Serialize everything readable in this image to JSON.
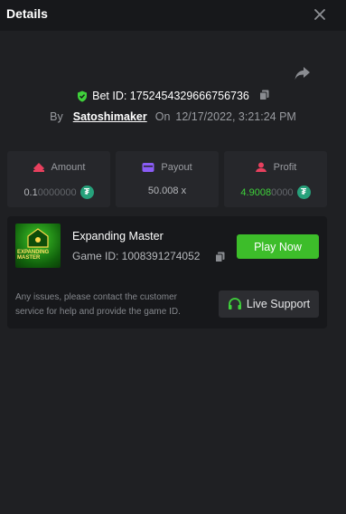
{
  "header": {
    "title": "Details"
  },
  "bet": {
    "id_label": "Bet ID: 1752454329666756736",
    "by_label": "By",
    "user": "Satoshimaker",
    "on_label": "On",
    "date": "12/17/2022, 3:21:24 PM"
  },
  "stats": {
    "amount": {
      "label": "Amount",
      "value_main": "0.1",
      "value_dim": "0000000"
    },
    "payout": {
      "label": "Payout",
      "value": "50.008 x"
    },
    "profit": {
      "label": "Profit",
      "value_main": "4.9008",
      "value_dim": "0000"
    }
  },
  "game": {
    "name": "Expanding Master",
    "id_label": "Game ID: 1008391274052",
    "thumb_text": "EXPANDING MASTER",
    "play_label": "Play Now",
    "notice": "Any issues, please contact the customer service for help and provide the game ID.",
    "support_label": "Live Support"
  },
  "colors": {
    "background": "#1f2023",
    "accent_green": "#3dbd2a",
    "tether": "#26a17b",
    "amount_icon": "#e8405e",
    "payout_icon": "#8a5cf6",
    "profit_icon": "#e8405e"
  },
  "icons": {
    "close": "close-icon",
    "share": "share-icon",
    "verified": "shield-check-icon",
    "copy": "copy-icon",
    "amount": "ticket-icon",
    "payout": "wallet-icon",
    "profit": "profit-icon",
    "currency": "tether-icon",
    "support": "headset-icon"
  }
}
